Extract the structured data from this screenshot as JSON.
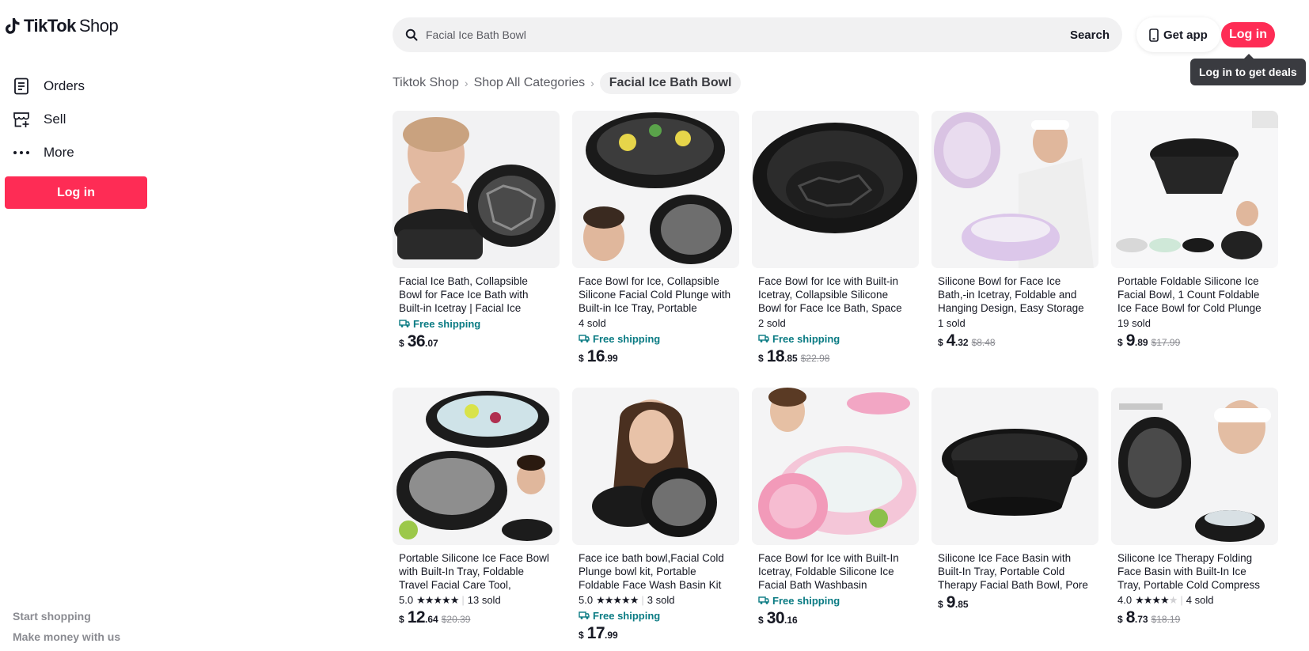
{
  "brand": {
    "name": "TikTok",
    "suffix": "Shop"
  },
  "sidebar": {
    "items": [
      {
        "label": "Orders",
        "icon": "orders-icon"
      },
      {
        "label": "Sell",
        "icon": "store-add-icon"
      },
      {
        "label": "More",
        "icon": "more-dots-icon"
      }
    ],
    "login_label": "Log in",
    "footer": [
      "Start shopping",
      "Make money with us"
    ]
  },
  "header": {
    "search_value": "Facial Ice Bath Bowl",
    "search_button": "Search",
    "get_app": "Get app",
    "login": "Log in",
    "tooltip": "Log in to get deals"
  },
  "breadcrumb": [
    "Tiktok Shop",
    "Shop All Categories",
    "Facial Ice Bath Bowl"
  ],
  "colors": {
    "accent": "#fe2c55",
    "shipping": "#0a7b83"
  },
  "products": [
    {
      "title": "Facial Ice Bath, Collapsible Bowl for Face Ice Bath with Built-in Icetray | Facial Ice Therapy for A...",
      "sold": "",
      "rating": "",
      "free_shipping": "Free shipping",
      "price_whole": "36",
      "price_cents": ".07",
      "original": ""
    },
    {
      "title": "Face Bowl for Ice, Collapsible Silicone Facial Cold Plunge with Built-in Ice Tray, Portable Foldin...",
      "sold": "4 sold",
      "rating": "",
      "free_shipping": "Free shipping",
      "price_whole": "16",
      "price_cents": ".99",
      "original": ""
    },
    {
      "title": "Face Bowl for Ice with Built-in Icetray, Collapsible Silicone Bowl for Face Ice Bath, Space Savin...",
      "sold": "2 sold",
      "rating": "",
      "free_shipping": "Free shipping",
      "price_whole": "18",
      "price_cents": ".85",
      "original": "$22.98"
    },
    {
      "title": "Silicone Bowl for Face Ice Bath,-in Icetray, Foldable and Hanging Design, Easy Storage and Carr...",
      "sold": "1 sold",
      "rating": "",
      "free_shipping": "",
      "price_whole": "4",
      "price_cents": ".32",
      "original": "$8.48"
    },
    {
      "title": "Portable Foldable Silicone Ice Facial Bowl, 1 Count Foldable Ice Face Bowl for Cold Plunge The...",
      "sold": "19 sold",
      "rating": "",
      "free_shipping": "",
      "price_whole": "9",
      "price_cents": ".89",
      "original": "$17.99"
    },
    {
      "title": "Portable Silicone Ice Face Bowl with Built-In Tray, Foldable Travel Facial Care Tool, Tightening ...",
      "sold": "13 sold",
      "rating": "5.0",
      "stars": 5,
      "free_shipping": "",
      "price_whole": "12",
      "price_cents": ".64",
      "original": "$20.39"
    },
    {
      "title": "Face ice bath bowl,Facial Cold Plunge bowl kit, Portable Foldable Face Wash Basin Kit",
      "sold": "3 sold",
      "rating": "5.0",
      "stars": 5,
      "free_shipping": "Free shipping",
      "price_whole": "17",
      "price_cents": ".99",
      "original": ""
    },
    {
      "title": "Face Bowl for Ice with Built-In Icetray, Foldable Silicone Ice Facial Bath Washbasin",
      "sold": "",
      "rating": "",
      "free_shipping": "Free shipping",
      "price_whole": "30",
      "price_cents": ".16",
      "original": ""
    },
    {
      "title": "Silicone Ice Face Basin with Built-In Tray, Portable Cold Therapy Facial Bath Bowl, Pore Constri...",
      "sold": "",
      "rating": "",
      "free_shipping": "",
      "price_whole": "9",
      "price_cents": ".85",
      "original": ""
    },
    {
      "title": "Silicone Ice Therapy Folding Face Basin with Built-In Ice Tray, Portable Cold Compress Facial B...",
      "sold": "4 sold",
      "rating": "4.0",
      "stars": 4,
      "free_shipping": "",
      "price_whole": "8",
      "price_cents": ".73",
      "original": "$18.19"
    }
  ]
}
